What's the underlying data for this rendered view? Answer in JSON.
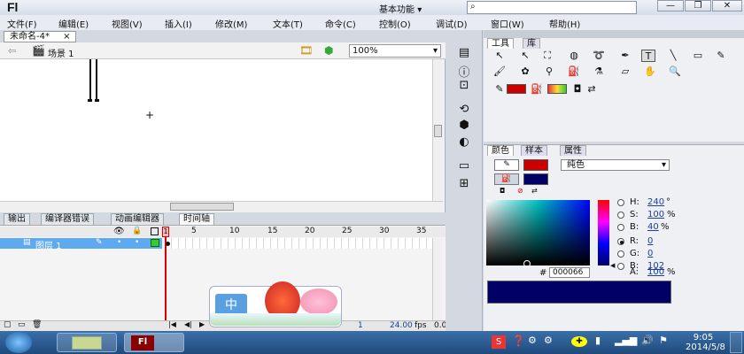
{
  "app": {
    "logo": "Fl",
    "workspace": "基本功能",
    "search_icon": "search-icon"
  },
  "window_controls": {
    "minimize": "—",
    "restore": "❐",
    "close": "✕"
  },
  "menu": [
    "文件(F)",
    "编辑(E)",
    "视图(V)",
    "插入(I)",
    "修改(M)",
    "文本(T)",
    "命令(C)",
    "控制(O)",
    "调试(D)",
    "窗口(W)",
    "帮助(H)"
  ],
  "document": {
    "tab_label": "未命名-4*",
    "tab_close": "×",
    "scene_label": "场景 1",
    "zoom": "100%"
  },
  "bottom_tabs": [
    "输出",
    "编译器错误",
    "动画编辑器",
    "时间轴"
  ],
  "timeline": {
    "frame_numbers": [
      "1",
      "5",
      "10",
      "15",
      "20",
      "25",
      "30",
      "35"
    ],
    "layer_name": "图层 1",
    "footer_frame": "1",
    "footer_fps": "24.00",
    "footer_fps_unit": "fps",
    "footer_time": "0.0"
  },
  "tools_panel": {
    "tabs": [
      "工具",
      "库"
    ]
  },
  "color_panel": {
    "tabs": [
      "颜色",
      "样本",
      "属性"
    ],
    "fill_type": "纯色",
    "stroke_color": "#cc0000",
    "fill_color": "#000066",
    "hex_label": "#",
    "hex_value": "000066",
    "hsb": [
      {
        "label": "H:",
        "value": "240",
        "unit": "°"
      },
      {
        "label": "S:",
        "value": "100",
        "unit": "%"
      },
      {
        "label": "B:",
        "value": "40",
        "unit": "%"
      }
    ],
    "rgb": [
      {
        "label": "R:",
        "value": "0",
        "unit": ""
      },
      {
        "label": "G:",
        "value": "0",
        "unit": ""
      },
      {
        "label": "B:",
        "value": "102",
        "unit": ""
      },
      {
        "label": "A:",
        "value": "100",
        "unit": "%"
      }
    ]
  },
  "ime": {
    "label": "中"
  },
  "clock": {
    "time": "9:05",
    "date": "2014/5/8"
  }
}
